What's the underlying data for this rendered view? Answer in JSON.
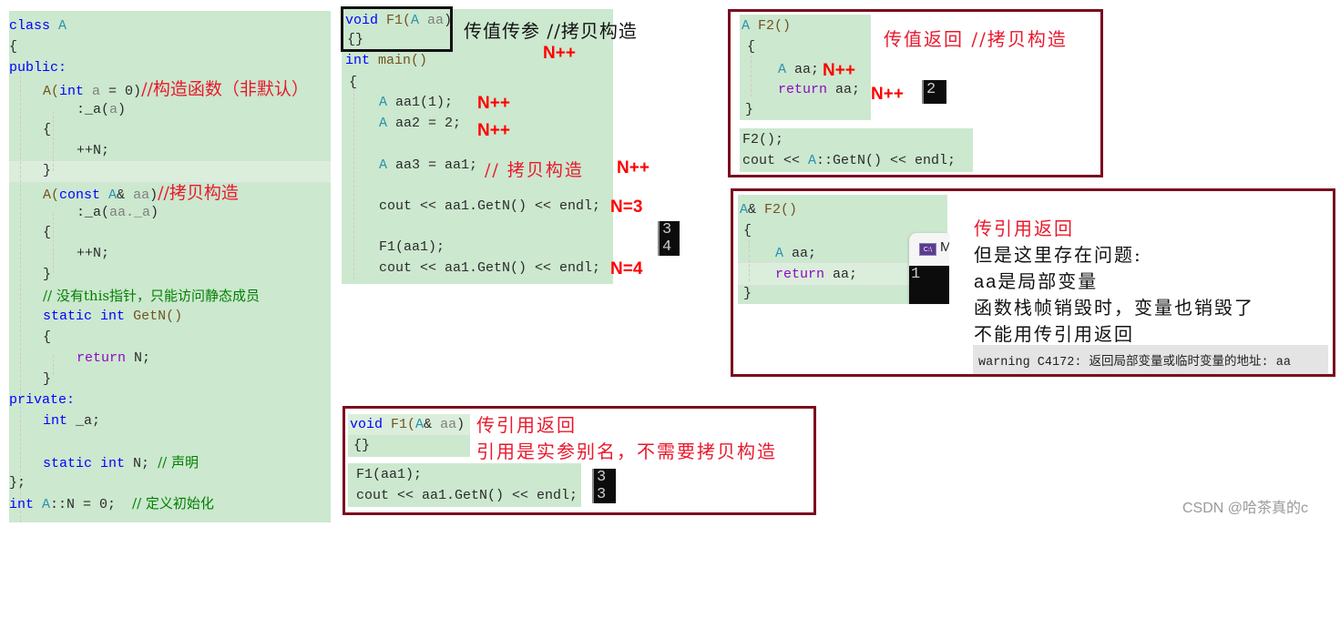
{
  "left_panel": {
    "lines": [
      {
        "t1": "class ",
        "t2": "A"
      },
      {
        "t": "{"
      },
      {
        "t": "public:"
      },
      {
        "ctor": "A(",
        "kw": "int",
        "pm": " a",
        "rest": " = 0)",
        "note": "//构造函数（非默认）"
      },
      {
        "t": ":_a(",
        "pm": "a",
        "t2": ")"
      },
      {
        "t": "{"
      },
      {
        "t": "++N;"
      },
      {
        "t": "}"
      },
      {
        "ctor": "A(",
        "kw": "const",
        "ty": " A",
        "amp": "&",
        "pm": " aa",
        "rest": ")",
        "note": "//拷贝构造"
      },
      {
        "t": ":_a(",
        "pm": "aa._a",
        "t2": ")"
      },
      {
        "t": "{"
      },
      {
        "t": "++N;"
      },
      {
        "t": "}"
      },
      {
        "comment": "// 没有this指针，只能访问静态成员"
      },
      {
        "kw1": "static",
        "kw2": "int",
        "fn": "GetN()"
      },
      {
        "t": "{"
      },
      {
        "ret": "return",
        "t": " N;"
      },
      {
        "t": "}"
      },
      {
        "t": "private:"
      },
      {
        "kw": "int",
        "t": " _a;"
      },
      {
        "t": ""
      },
      {
        "kw1": "static",
        "kw2": "int",
        "t": " N; ",
        "comment": "// 声明"
      },
      {
        "t": "};"
      },
      {
        "kw": "int",
        "ty": " A",
        "t": "::N = 0;  ",
        "comment": "// 定义初始化"
      }
    ]
  },
  "pass_by_value": {
    "func_line1": {
      "kw": "void",
      "fn": " F1(",
      "ty": "A",
      "pm": " aa",
      "t": ")"
    },
    "func_line2": "{}",
    "main_sig": {
      "kw": "int",
      "t": " main()"
    },
    "open_brace": "{",
    "stmt1": {
      "ty": "A",
      "t": " aa1(1);"
    },
    "stmt2": {
      "ty": "A",
      "t": " aa2 = 2;"
    },
    "stmt3": {
      "ty": "A",
      "t": " aa3 = aa1;",
      "comment": "// 拷贝构造"
    },
    "stmt4": "cout << aa1.GetN() << endl;",
    "stmt5": "F1(aa1);",
    "stmt6": "cout << aa1.GetN() << endl;",
    "title_note": "传值传参 //拷贝构造",
    "n_marks": [
      "N++",
      "N++",
      "N++",
      "N++",
      "N=3",
      "N=4"
    ],
    "console_output": [
      "3",
      "4"
    ]
  },
  "return_by_value": {
    "sig": {
      "ty": "A",
      "fn": " F2()"
    },
    "open": "{",
    "body1": {
      "ty": "A",
      "t": " aa;"
    },
    "body2": {
      "ret": "return",
      "t": " aa;"
    },
    "close": "}",
    "call1": "F2();",
    "call2": {
      "t1": "cout << ",
      "ty": "A",
      "t2": "::GetN() << endl;"
    },
    "title_note": "传值返回 //拷贝构造",
    "n_marks": [
      "N++",
      "N++"
    ],
    "console_output": [
      "2"
    ]
  },
  "return_by_ref": {
    "sig": {
      "ty": "A",
      "amp": "&",
      "fn": " F2()"
    },
    "open": "{",
    "body1": {
      "ty": "A",
      "t": " aa;"
    },
    "body2": {
      "ret": "return",
      "t": " aa;"
    },
    "close": "}",
    "console_title": "M",
    "console_output": [
      "1"
    ],
    "notes": {
      "title": "传引用返回",
      "line1": "但是这里存在问题:",
      "line2_prefix": "aa",
      "line2": "是局部变量",
      "line3": "函数栈帧销毁时，变量也销毁了",
      "line4": "不能用传引用返回"
    },
    "warning": "warning C4172: 返回局部变量或临时变量的地址: aa"
  },
  "pass_by_ref": {
    "sig": {
      "kw": "void",
      "fn": " F1(",
      "ty": "A",
      "amp": "&",
      "pm": " aa",
      "t": ")"
    },
    "body": "{}",
    "call1": "F1(aa1);",
    "call2": "cout << aa1.GetN() << endl;",
    "note1": "传引用返回",
    "note2": "引用是实参别名，不需要拷贝构造",
    "console_output": [
      "3",
      "3"
    ]
  },
  "watermark": "CSDN @哈茶真的c",
  "colors": {
    "code_bg": "#cce8cf",
    "frame": "#7b0c1f",
    "note_red": "#e8192c",
    "keyword": "#0000ff",
    "type": "#2b91af"
  }
}
